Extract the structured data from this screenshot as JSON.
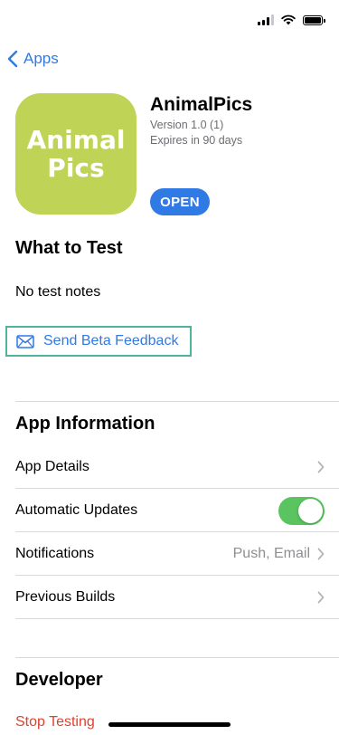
{
  "status_bar": {
    "signal_icon": "cellular-signal-icon",
    "wifi_icon": "wifi-icon",
    "battery_icon": "battery-icon"
  },
  "nav": {
    "back_label": "Apps",
    "back_icon": "chevron-left-icon"
  },
  "app": {
    "icon_line1": "Animal",
    "icon_line2": "Pics",
    "icon_color": "#bfd356",
    "name": "AnimalPics",
    "version": "Version 1.0 (1)",
    "expiry": "Expires in 90 days",
    "open_label": "OPEN"
  },
  "what_to_test": {
    "heading": "What to Test",
    "notes": "No test notes",
    "feedback_label": "Send Beta Feedback",
    "feedback_icon": "envelope-icon"
  },
  "app_information": {
    "heading": "App Information",
    "rows": [
      {
        "label": "App Details",
        "value": ""
      },
      {
        "label": "Automatic Updates",
        "value": "",
        "toggle_on": true
      },
      {
        "label": "Notifications",
        "value": "Push, Email"
      },
      {
        "label": "Previous Builds",
        "value": ""
      }
    ]
  },
  "developer": {
    "heading": "Developer",
    "stop_label": "Stop Testing"
  },
  "colors": {
    "accent": "#2f7ae5",
    "toggle_on": "#5ac460",
    "destructive": "#e0412f",
    "highlight": "#52b39a"
  }
}
